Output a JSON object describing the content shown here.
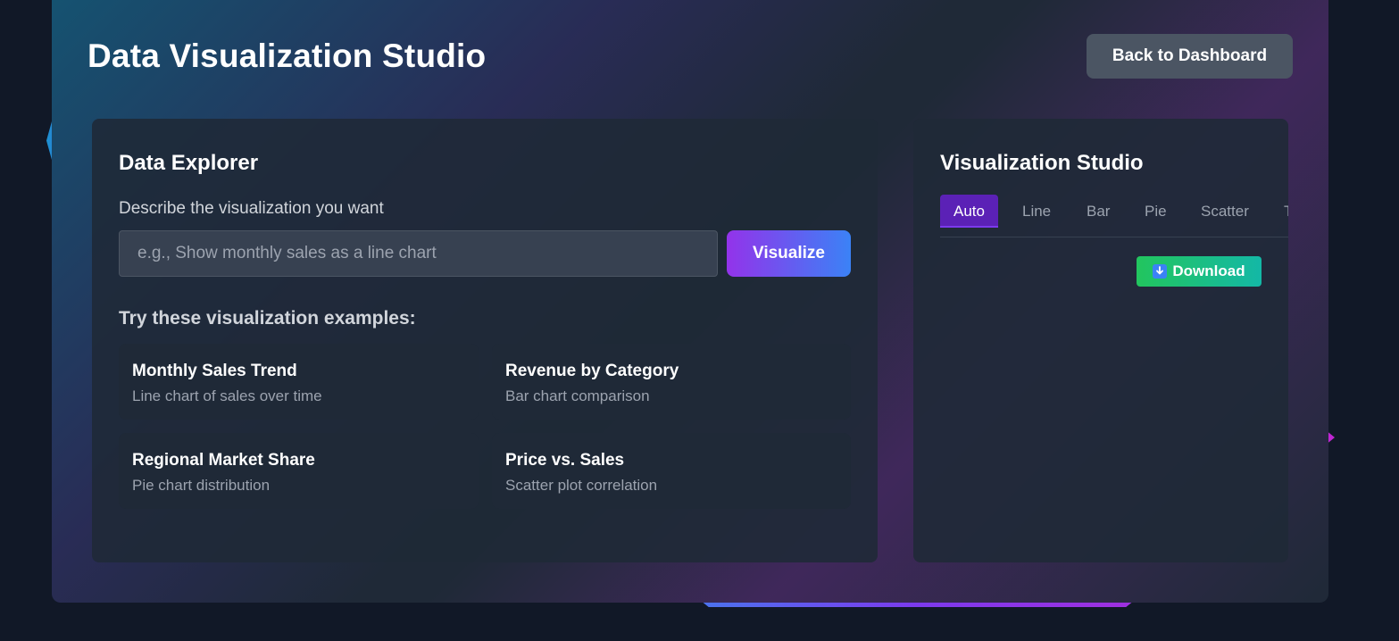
{
  "header": {
    "title": "Data Visualization Studio",
    "back_label": "Back to Dashboard"
  },
  "explorer": {
    "title": "Data Explorer",
    "prompt_label": "Describe the visualization you want",
    "prompt_value": "",
    "prompt_placeholder": "e.g., Show monthly sales as a line chart",
    "visualize_label": "Visualize",
    "examples_heading": "Try these visualization examples:",
    "examples": [
      {
        "title": "Monthly Sales Trend",
        "description": "Line chart of sales over time"
      },
      {
        "title": "Revenue by Category",
        "description": "Bar chart comparison"
      },
      {
        "title": "Regional Market Share",
        "description": "Pie chart distribution"
      },
      {
        "title": "Price vs. Sales",
        "description": "Scatter plot correlation"
      }
    ]
  },
  "studio": {
    "title": "Visualization Studio",
    "tabs": [
      {
        "label": "Auto",
        "active": true
      },
      {
        "label": "Line",
        "active": false
      },
      {
        "label": "Bar",
        "active": false
      },
      {
        "label": "Pie",
        "active": false
      },
      {
        "label": "Scatter",
        "active": false
      },
      {
        "label": "Table",
        "active": false
      }
    ],
    "download_label": "Download",
    "download_icon": "download-arrow-icon"
  },
  "colors": {
    "background": "#111827",
    "surface": "#1f2937",
    "accent_purple": "#9333ea",
    "accent_blue": "#3b82f6",
    "accent_green": "#22c55e",
    "active_tab": "#5b21b6"
  }
}
